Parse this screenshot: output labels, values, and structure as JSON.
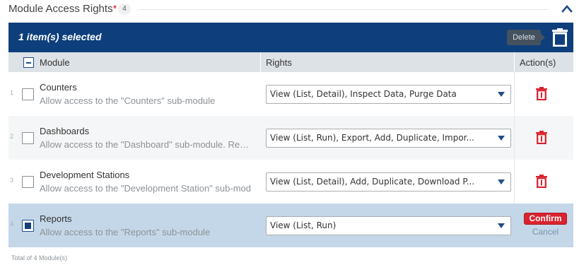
{
  "section": {
    "title": "Module Access Rights",
    "required_marker": "*",
    "count": "4"
  },
  "selection_bar": {
    "text": "1 item(s) selected",
    "delete_tooltip": "Delete"
  },
  "table": {
    "columns": {
      "module": "Module",
      "rights": "Rights",
      "actions": "Action(s)"
    },
    "rows": [
      {
        "num": "1",
        "name": "Counters",
        "description": "Allow access to the \"Counters\" sub-module",
        "rights": "View (List, Detail), Inspect Data, Purge Data",
        "checked": false
      },
      {
        "num": "2",
        "name": "Dashboards",
        "description": "Allow access to the \"Dashboard\" sub-module. Requi",
        "rights": "View (List, Run), Export, Add, Duplicate, Impor...",
        "checked": false
      },
      {
        "num": "3",
        "name": "Development Stations",
        "description": "Allow access to the \"Development Station\" sub-mod",
        "rights": "View (List, Detail), Add, Duplicate, Download P...",
        "checked": false
      },
      {
        "num": "4",
        "name": "Reports",
        "description": "Allow access to the \"Reports\" sub-module",
        "rights": "View (List, Run)",
        "checked": true,
        "confirm_label": "Confirm",
        "cancel_label": "Cancel"
      }
    ]
  },
  "footer": {
    "total": "Total of 4 Module(s)"
  },
  "colors": {
    "selection_bar": "#0e3f7c",
    "danger": "#d9232e",
    "selected_row": "#c4d7e8",
    "header_row": "#dde2e6"
  },
  "icons": {
    "collapse": "chevron-up-icon",
    "bulk_delete": "trash-icon",
    "row_delete": "trash-icon",
    "select_arrow": "caret-down-icon"
  }
}
